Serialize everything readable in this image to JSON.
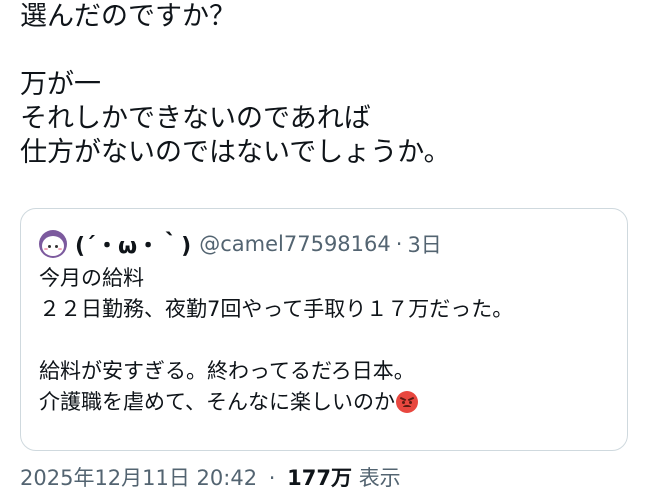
{
  "post": {
    "lines": [
      "選んだのですか？",
      "",
      "万が一",
      "それしかできないのであれば",
      "仕方がないのではないでしょうか。"
    ]
  },
  "quote": {
    "avatar_icon": "cartoon-face-avatar-icon",
    "display_name": "(´・ω・｀)",
    "handle": "@camel77598164",
    "separator": "·",
    "relative_time": "3日",
    "lines": [
      "今月の給料",
      "２２日勤務、夜勤7回やって手取り１７万だった。",
      "",
      "給料が安すぎる。終わってるだろ日本。",
      "介護職を虐めて、そんなに楽しいのか"
    ],
    "trailing_emoji": "angry-face-emoji"
  },
  "meta": {
    "timestamp": "2025年12月11日 20:42",
    "separator": "·",
    "views_count": "177万",
    "views_label": "表示"
  }
}
